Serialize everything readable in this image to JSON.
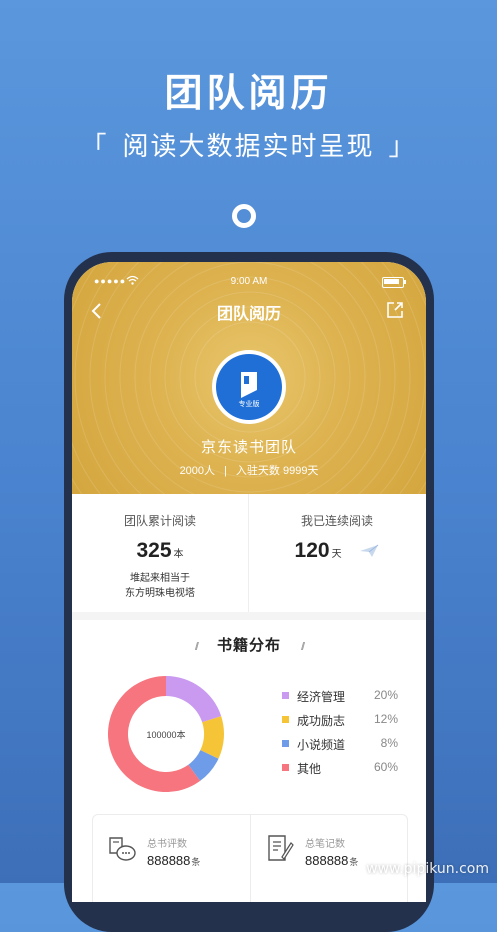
{
  "promo": {
    "title": "团队阅历",
    "subtitle_bracket_left": "「",
    "subtitle": "阅读大数据实时呈现",
    "subtitle_bracket_right": "」"
  },
  "status_bar": {
    "signal": "●●●●●",
    "time": "9:00 AM"
  },
  "nav": {
    "title": "团队阅历"
  },
  "team": {
    "logo_tag": "专业版",
    "name": "京东读书团队",
    "members": "2000人",
    "separator": "|",
    "days": "入驻天数 9999天"
  },
  "stats": {
    "cumulative": {
      "label": "团队累计阅读",
      "value": "325",
      "unit": "本",
      "note_line1": "堆起来相当于",
      "note_line2": "东方明珠电视塔"
    },
    "streak": {
      "label": "我已连续阅读",
      "value": "120",
      "unit": "天"
    }
  },
  "distribution": {
    "slashes": "//",
    "title": "书籍分布",
    "center_label": "100000本",
    "categories": [
      {
        "name": "经济管理",
        "percent": "20%",
        "value": 20,
        "color": "#c99af0"
      },
      {
        "name": "成功励志",
        "percent": "12%",
        "value": 12,
        "color": "#f6c437"
      },
      {
        "name": "小说频道",
        "percent": "8%",
        "value": 8,
        "color": "#6f9ce8"
      },
      {
        "name": "其他",
        "percent": "60%",
        "value": 60,
        "color": "#f6757e"
      }
    ]
  },
  "cards": {
    "reviews": {
      "label": "总书评数",
      "value": "888888",
      "unit": "条"
    },
    "notes": {
      "label": "总笔记数",
      "value": "888888",
      "unit": "条"
    }
  },
  "watermark": "www.pipikun.com"
}
